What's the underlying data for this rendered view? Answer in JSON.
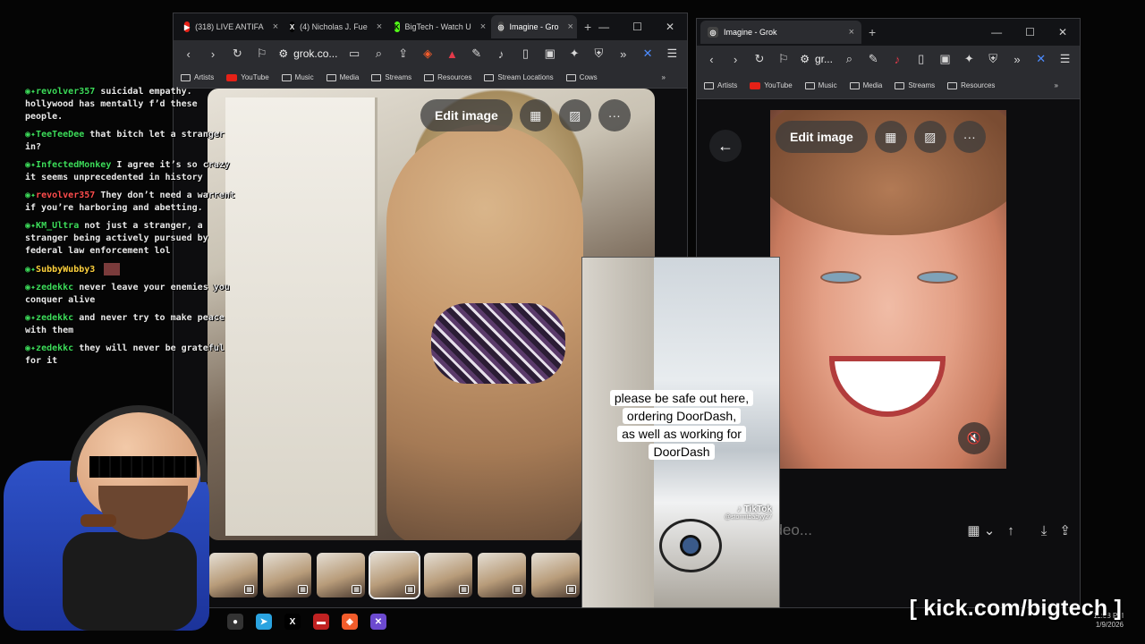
{
  "left_browser": {
    "tabs": [
      {
        "label": "(318) LIVE ANTIFA",
        "icon": "youtube-icon",
        "color": "#e62117"
      },
      {
        "label": "(4) Nicholas J. Fue",
        "icon": "x-icon",
        "color": "#000000"
      },
      {
        "label": "BigTech - Watch U",
        "icon": "kick-icon",
        "color": "#53fc18"
      },
      {
        "label": "Imagine - Gro",
        "icon": "grok-icon",
        "color": "#444444",
        "active": true
      }
    ],
    "url": "grok.co...",
    "bookmarks": [
      "Artists",
      "YouTube",
      "Music",
      "Media",
      "Streams",
      "Resources",
      "Stream Locations",
      "Cows"
    ],
    "edit_image_label": "Edit image"
  },
  "right_browser": {
    "tab": "Imagine - Grok",
    "url": "gr...",
    "bookmarks": [
      "Artists",
      "YouTube",
      "Music",
      "Media",
      "Streams",
      "Resources"
    ],
    "edit_image_label": "Edit image",
    "prompt_placeholder": "e video..."
  },
  "tiktok": {
    "caption_lines": [
      "please be safe out here,",
      "ordering DoorDash,",
      "as well as working for",
      "DoorDash"
    ],
    "logo": "TikTok",
    "handle": "@stormtbabyy27"
  },
  "chat": [
    {
      "user": "revolver357",
      "user_color": "#3ddc5a",
      "text": "suicidal empathy. hollywood has mentally f’d these people."
    },
    {
      "user": "TeeTeeDee",
      "user_color": "#3ddc5a",
      "text": "that bitch let a stranger in?"
    },
    {
      "user": "InfectedMonkey",
      "user_color": "#3ddc5a",
      "text": "I agree it’s so crazy it seems unprecedented in history"
    },
    {
      "user": "revolver357",
      "user_color": "#ff4d4d",
      "text": "They don’t need a warrent if you’re harboring and abetting."
    },
    {
      "user": "KM_Ultra",
      "user_color": "#3ddc5a",
      "text": "not just a stranger, a stranger being actively pursued by federal law enforcement lol"
    },
    {
      "user": "SubbyWubby3",
      "user_color": "#ffd23d",
      "text": ""
    },
    {
      "user": "zedekkc",
      "user_color": "#3ddc5a",
      "text": "never leave your enemies you conquer alive"
    },
    {
      "user": "zedekkc",
      "user_color": "#3ddc5a",
      "text": "and never try to make peace with them"
    },
    {
      "user": "zedekkc",
      "user_color": "#3ddc5a",
      "text": "they will never be grateful for it"
    }
  ],
  "clock": {
    "time": "11:58 PM",
    "date": "1/9/2026"
  },
  "watermark": "[ kick.com/bigtech ]"
}
